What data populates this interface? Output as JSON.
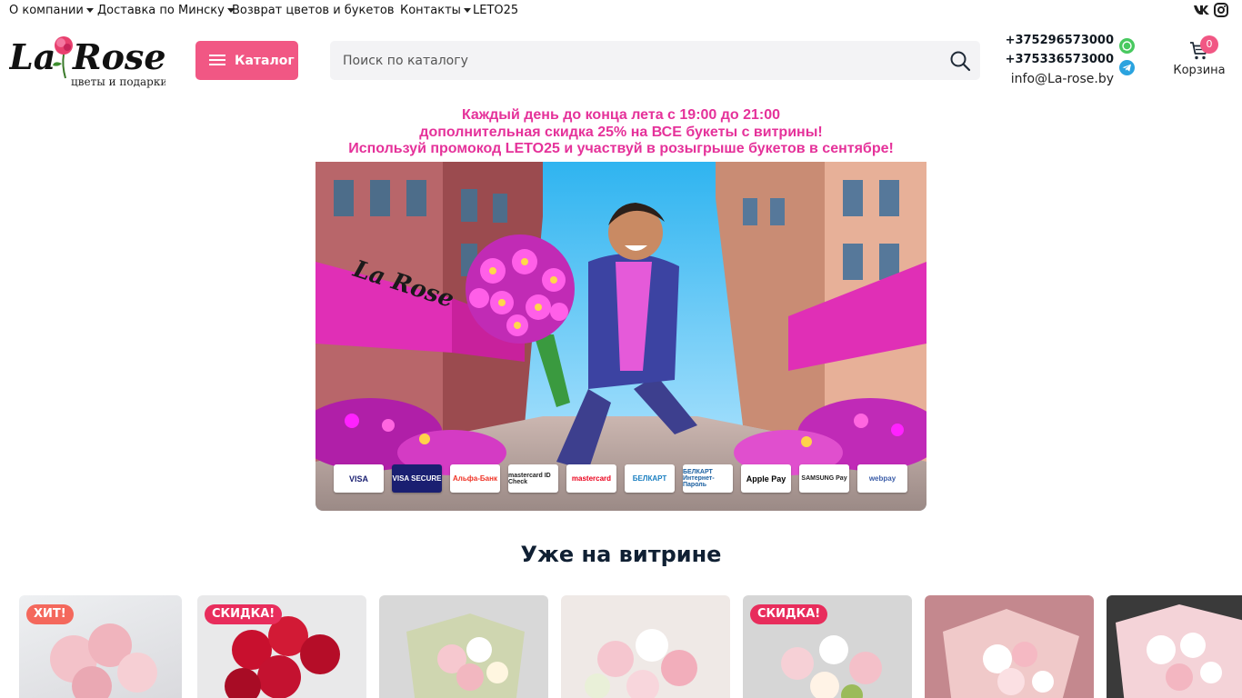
{
  "topnav": {
    "items": [
      {
        "label": "О компании",
        "dropdown": true
      },
      {
        "label": "Доставка по Минску",
        "dropdown": true
      },
      {
        "label": "Возврат цветов и букетов",
        "dropdown": false
      },
      {
        "label": "Контакты",
        "dropdown": true
      },
      {
        "label": "LETO25",
        "dropdown": false
      }
    ],
    "social": [
      "vk-icon",
      "instagram-icon"
    ]
  },
  "header": {
    "logo_text": "La Rose",
    "logo_subtitle": "цветы и подарки",
    "catalog_label": "Каталог",
    "search_placeholder": "Поиск по каталогу",
    "phones": [
      "+375296573000",
      "+375336573000"
    ],
    "email": "info@La-rose.by",
    "cart": {
      "count": "0",
      "label": "Корзина"
    }
  },
  "banner": {
    "promo_lines": [
      "Каждый день до конца лета с 19:00 до 21:00",
      "дополнительная скидка 25% на ВСЕ букеты с витрины!",
      "Используй промокод LETO25 и участвуй в розыгрыше букетов в сентябре!"
    ],
    "image_logo_text": "La Rose",
    "payments": [
      "VISA",
      "VISA SECURE",
      "Альфа-Банк",
      "mastercard ID Check",
      "mastercard",
      "БЕЛКАРТ",
      "БЕЛКАРТ Интернет-Пароль",
      "Apple Pay",
      "SAMSUNG Pay",
      "webpay"
    ]
  },
  "section": {
    "title": "Уже на витрине",
    "cards": [
      {
        "badge": "ХИТ!",
        "badge_type": "hit"
      },
      {
        "badge": "СКИДКА!",
        "badge_type": "sale"
      },
      {
        "badge": "",
        "badge_type": ""
      },
      {
        "badge": "",
        "badge_type": ""
      },
      {
        "badge": "СКИДКА!",
        "badge_type": "sale"
      },
      {
        "badge": "",
        "badge_type": ""
      },
      {
        "badge": "",
        "badge_type": ""
      }
    ]
  },
  "colors": {
    "accent": "#f15784",
    "promo_text": "#e5329a",
    "heading": "#102033",
    "badge_hit": "#f4685c",
    "badge_sale": "#e82d5c"
  }
}
